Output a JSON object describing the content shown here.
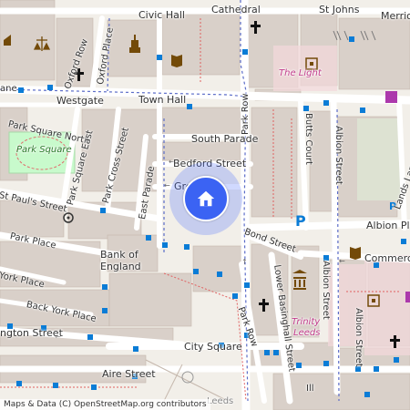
{
  "attribution": "Maps & Data (C) OpenStreetMap.org contributors",
  "marker": {
    "icon": "home-icon",
    "color": "#3b63f3"
  },
  "streets": {
    "civic_hall": "Civic Hall",
    "cathedral": "Cathedral",
    "st_johns": "St Johns",
    "merrion": "Merrio",
    "oxford_row": "Oxford Row",
    "oxford_place": "Oxford Place",
    "westgate": "Westgate",
    "town_hall": "Town Hall",
    "park_square_north": "Park Square North",
    "park_square": "Park Square",
    "park_square_east": "Park Square East",
    "park_cross_street": "Park Cross Street",
    "south_parade": "South Parade",
    "bedford_street": "Bedford Street",
    "east_parade": "East Parade",
    "greek_street": "Gre",
    "st_pauls_street": "St Paul's Street",
    "park_place": "Park Place",
    "york_place": "York Place",
    "back_york_place": "Back York Place",
    "wellington_street": "ngton Street",
    "park_row_north": "Park Row",
    "park_row_south": "Park Row",
    "bond_street": "Bond Street",
    "butts_court": "Butts Court",
    "albion_street_north": "Albion Street",
    "albion_street_south": "Albion Street",
    "albion_street_mid": "Albion Street",
    "albion_place": "Albion Place",
    "lands_lane": "Lands Lane",
    "commercial_street": "Commercial",
    "lower_basinghall_street": "Lower Basinghall Street",
    "city_square": "City Square",
    "aire_street": "Aire Street",
    "leeds_station": "Leeds",
    "ll": "Ill"
  },
  "pois": {
    "bank_of_england_line1": "Bank of",
    "bank_of_england_line2": "England",
    "the_light": "The Light",
    "trinity_leeds_line1": "Trinity",
    "trinity_leeds_line2": "Leeds"
  },
  "colors": {
    "background": "#f2efe9",
    "building": "#d9d0c9",
    "road": "#ffffff",
    "park": "#c8facc",
    "bus_stop": "#0a7cd6",
    "boundary": "#5b6cc8",
    "poi_brown": "#734a08",
    "parking": "#0a7cd6"
  }
}
